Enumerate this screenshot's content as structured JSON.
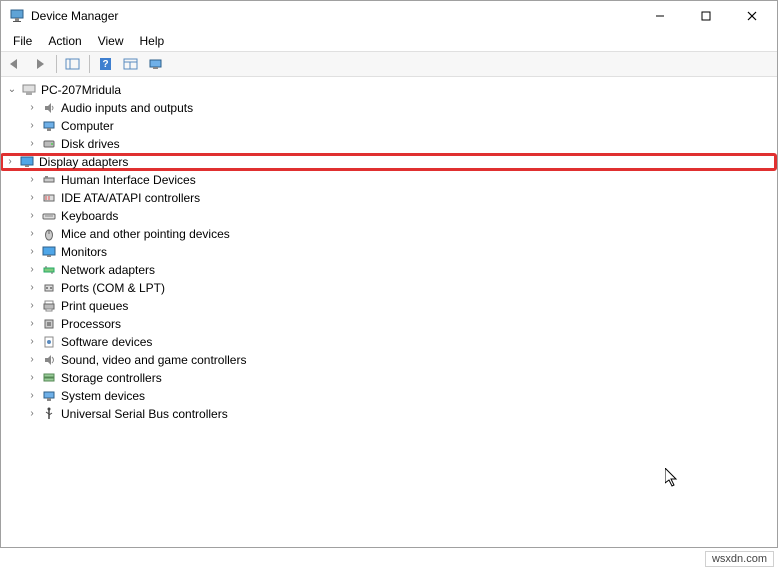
{
  "title": "Device Manager",
  "menu": {
    "file": "File",
    "action": "Action",
    "view": "View",
    "help": "Help"
  },
  "tree": {
    "root": "PC-207Mridula",
    "items": [
      "Audio inputs and outputs",
      "Computer",
      "Disk drives",
      "Display adapters",
      "Human Interface Devices",
      "IDE ATA/ATAPI controllers",
      "Keyboards",
      "Mice and other pointing devices",
      "Monitors",
      "Network adapters",
      "Ports (COM & LPT)",
      "Print queues",
      "Processors",
      "Software devices",
      "Sound, video and game controllers",
      "Storage controllers",
      "System devices",
      "Universal Serial Bus controllers"
    ]
  },
  "watermark": "wsxdn.com"
}
